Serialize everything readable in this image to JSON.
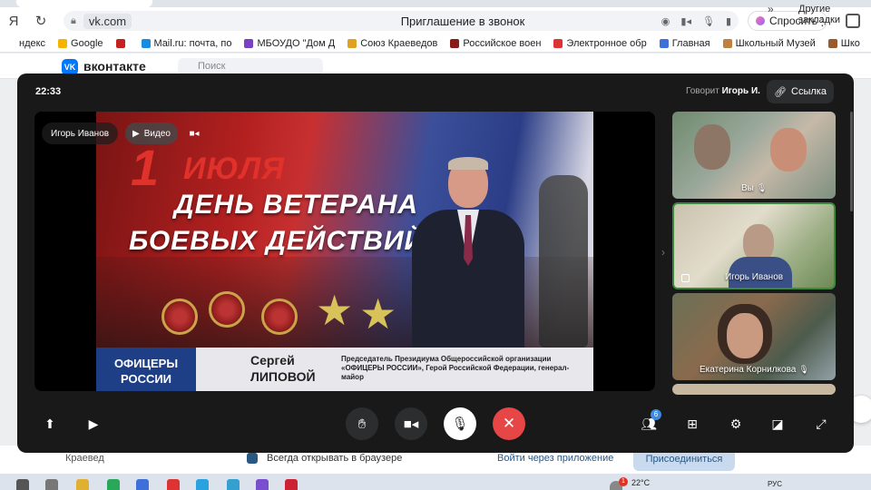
{
  "browser": {
    "url": "vk.com",
    "page_title": "Приглашение в звонок",
    "ask_label": "Спросить",
    "bookmarks": [
      {
        "label": "ндекс",
        "color": "#ffffff"
      },
      {
        "label": "Google",
        "color": "#f4b400"
      },
      {
        "label": "",
        "color": "#c5221f"
      },
      {
        "label": "Mail.ru: почта, по",
        "color": "#168de2"
      },
      {
        "label": "МБОУДО \"Дом Д",
        "color": "#7b3fc4"
      },
      {
        "label": "Союз Краеведов",
        "color": "#e0a020"
      },
      {
        "label": "Российское воен",
        "color": "#8a1a1a"
      },
      {
        "label": "Электронное обр",
        "color": "#d33"
      },
      {
        "label": "Главная",
        "color": "#3f6fd8"
      },
      {
        "label": "Школьный Музей",
        "color": "#c08040"
      },
      {
        "label": "Шко",
        "color": "#9a5a2a"
      }
    ],
    "bookmarks_more": "»",
    "other_bookmarks": "Другие закладки"
  },
  "vk": {
    "brand": "вконтакте",
    "search_placeholder": "Поиск",
    "kraeved": "Краевед",
    "always_open": "Всегда открывать в браузере",
    "open_app": "Войти через приложение",
    "join": "Присоединиться"
  },
  "call": {
    "time": "22:33",
    "speaking_prefix": "Говорит",
    "speaking_name": "Игорь И.",
    "link_label": "Ссылка",
    "main": {
      "presenter_name": "Игорь Иванов",
      "video_label": "Видео",
      "broadcast": {
        "date_num": "1",
        "date_word": "ИЮЛЯ",
        "title_line1": "ДЕНЬ ВЕТЕРАНА",
        "title_line2": "БОЕВЫХ ДЕЙСТВИЙ",
        "org_line1": "ОФИЦЕРЫ",
        "org_line2": "РОССИИ",
        "speaker_first": "Сергей",
        "speaker_last": "ЛИПОВОЙ",
        "speaker_role": "Председатель Президиума Общероссийской организации «ОФИЦЕРЫ РОССИИ», Герой Российской Федерации, генерал-майор"
      }
    },
    "participants": [
      {
        "label": "Вы",
        "muted": true
      },
      {
        "label": "Игорь Иванов",
        "muted": false
      },
      {
        "label": "Екатерина Корнилкова",
        "muted": true
      }
    ],
    "participants_count": "6"
  },
  "taskbar": {
    "notification_count": "1",
    "temperature": "22°C",
    "lang": "РУС"
  },
  "colors": {
    "call_bg": "#19191a",
    "end_call": "#e64646",
    "accent": "#3f8ae0"
  }
}
